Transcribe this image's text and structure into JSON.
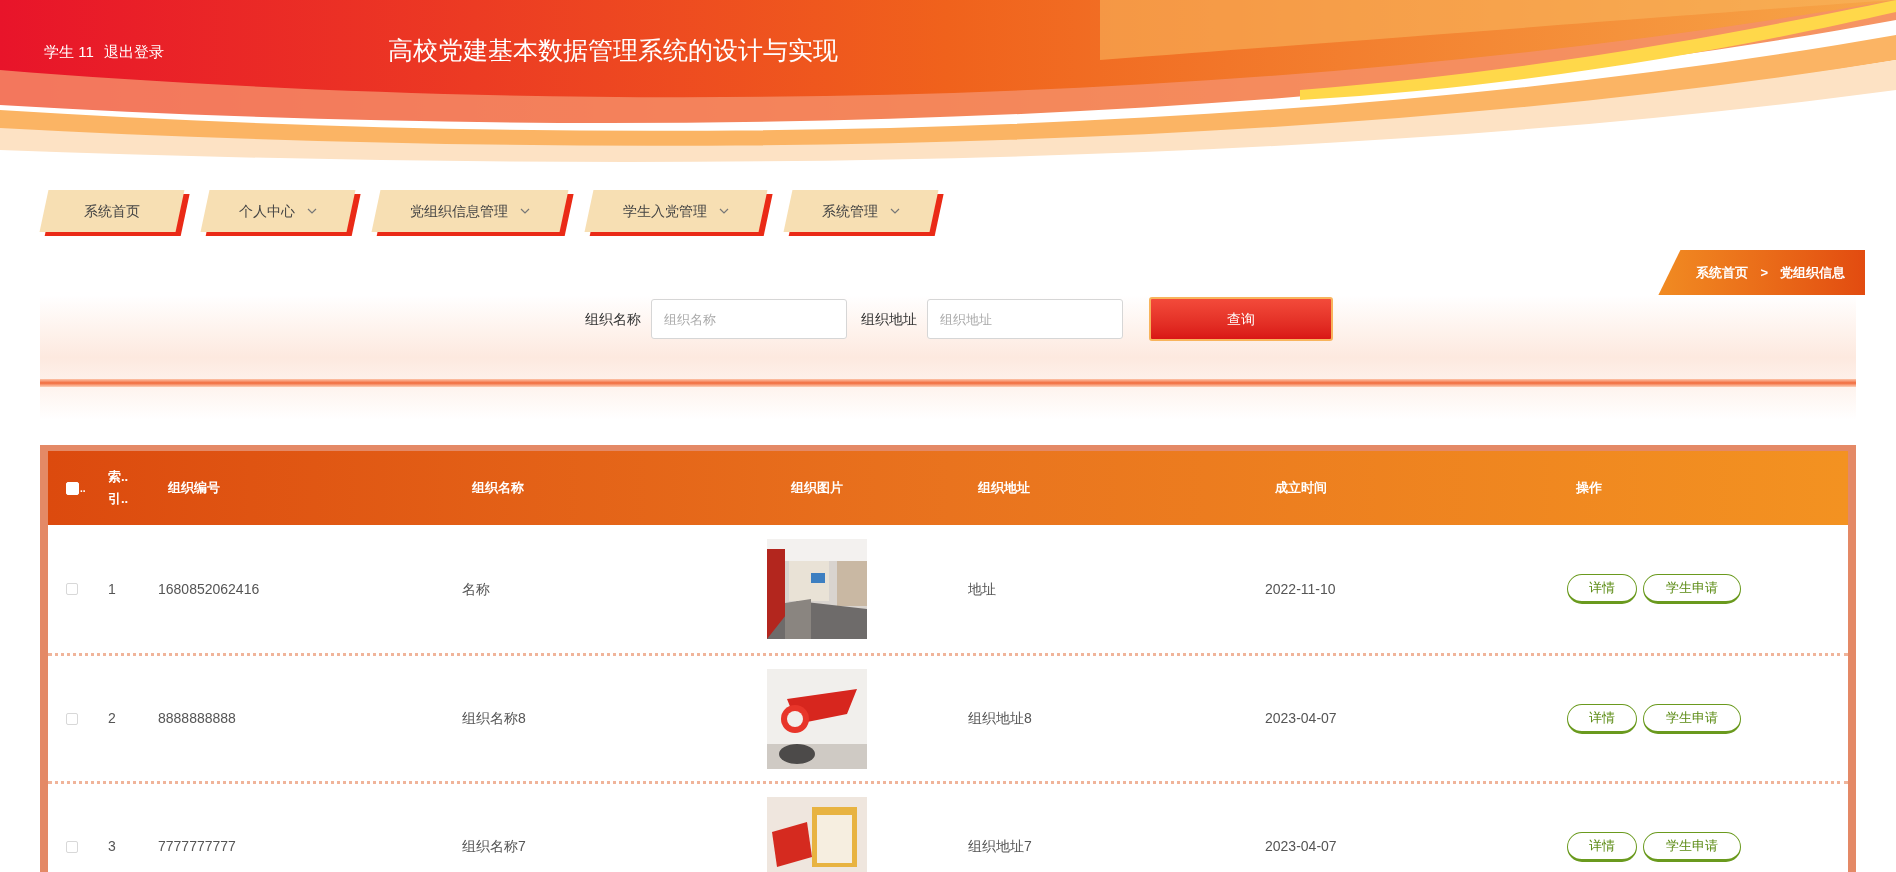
{
  "user": {
    "name": "学生 11",
    "logout": "退出登录"
  },
  "title": "高校党建基本数据管理系统的设计与实现",
  "nav": [
    {
      "label": "系统首页",
      "dropdown": false
    },
    {
      "label": "个人中心",
      "dropdown": true
    },
    {
      "label": "党组织信息管理",
      "dropdown": true
    },
    {
      "label": "学生入党管理",
      "dropdown": true
    },
    {
      "label": "系统管理",
      "dropdown": true
    }
  ],
  "breadcrumb": [
    "系统首页",
    ">",
    "党组织信息"
  ],
  "search": {
    "fields": [
      {
        "label": "组织名称",
        "placeholder": "组织名称"
      },
      {
        "label": "组织地址",
        "placeholder": "组织地址"
      }
    ],
    "button": "查询"
  },
  "table": {
    "select_all": {
      "checked": false,
      "suffix": ".."
    },
    "columns": [
      "索.. 引..",
      "组织编号",
      "组织名称",
      "组织图片",
      "组织地址",
      "成立时间",
      "操作"
    ],
    "rows": [
      {
        "checked": false,
        "index": "1",
        "code": "1680852062416",
        "name": "名称",
        "picture": {
          "kind": "picture"
        },
        "address": "地址",
        "date": "2022-11-10",
        "actions": [
          "详情",
          "学生申请"
        ]
      },
      {
        "checked": false,
        "index": "2",
        "code": "8888888888",
        "name": "组织名称8",
        "picture": {
          "kind": "picture"
        },
        "address": "组织地址8",
        "date": "2023-04-07",
        "actions": [
          "详情",
          "学生申请"
        ]
      },
      {
        "checked": false,
        "index": "3",
        "code": "7777777777",
        "name": "组织名称7",
        "picture": {
          "kind": "picture"
        },
        "address": "组织地址7",
        "date": "2023-04-07",
        "actions": [
          "详情",
          "学生申请"
        ]
      }
    ]
  }
}
